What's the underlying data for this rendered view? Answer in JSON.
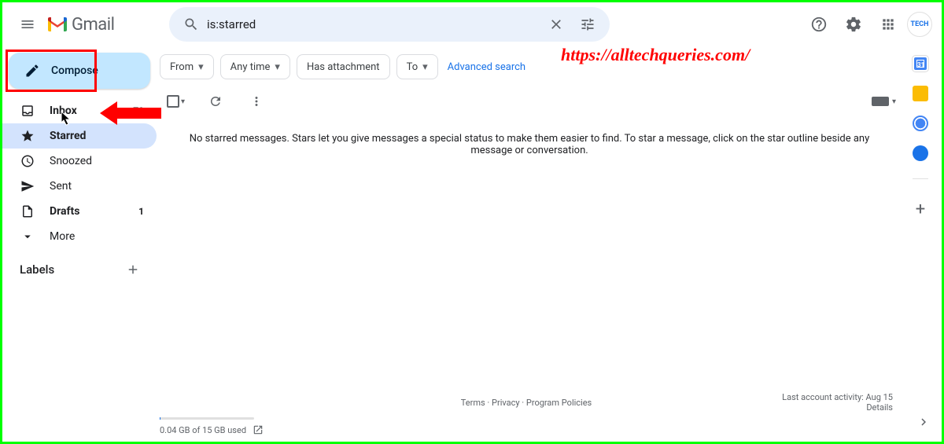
{
  "header": {
    "product": "Gmail",
    "search_value": "is:starred",
    "avatar_text": "TECH"
  },
  "overlay_url": "https://alltechqueries.com/",
  "sidebar": {
    "compose": "Compose",
    "items": [
      {
        "label": "Inbox",
        "count": "79"
      },
      {
        "label": "Starred",
        "count": ""
      },
      {
        "label": "Snoozed",
        "count": ""
      },
      {
        "label": "Sent",
        "count": ""
      },
      {
        "label": "Drafts",
        "count": "1"
      },
      {
        "label": "More",
        "count": ""
      }
    ],
    "labels_header": "Labels"
  },
  "chips": {
    "from": "From",
    "anytime": "Any time",
    "attachment": "Has attachment",
    "to": "To",
    "advanced": "Advanced search"
  },
  "main": {
    "empty": "No starred messages. Stars let you give messages a special status to make them easier to find. To star a message, click on the star outline beside any message or conversation."
  },
  "footer": {
    "terms": "Terms",
    "privacy": "Privacy",
    "policies": "Program Policies",
    "activity": "Last account activity: Aug 15",
    "details": "Details",
    "storage": "0.04 GB of 15 GB used"
  },
  "rail_colors": {
    "calendar": "#1a73e8",
    "keep": "#fbbc04",
    "tasks": "#4285f4",
    "contacts": "#1a73e8"
  }
}
